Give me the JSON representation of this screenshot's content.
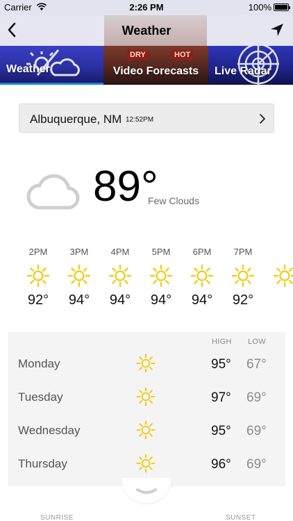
{
  "status_bar": {
    "carrier": "Carrier",
    "time": "2:26 PM",
    "battery": "100%"
  },
  "nav": {
    "title": "Weather"
  },
  "tabs": [
    {
      "label": "Weather",
      "selected": true
    },
    {
      "label": "Video Forecasts",
      "selected": false
    },
    {
      "label": "Live Radar",
      "selected": false
    }
  ],
  "video_signs": [
    "DRY",
    "HOT"
  ],
  "location": {
    "city": "Albuquerque, NM",
    "time": "12:52PM"
  },
  "current": {
    "temp": "89°",
    "condition": "Few Clouds",
    "icon": "cloud-icon"
  },
  "hourly": [
    {
      "time": "2PM",
      "temp": "92°",
      "icon": "sun-icon"
    },
    {
      "time": "3PM",
      "temp": "94°",
      "icon": "sun-icon"
    },
    {
      "time": "4PM",
      "temp": "94°",
      "icon": "sun-icon"
    },
    {
      "time": "5PM",
      "temp": "94°",
      "icon": "sun-icon"
    },
    {
      "time": "6PM",
      "temp": "94°",
      "icon": "sun-icon"
    },
    {
      "time": "7PM",
      "temp": "92°",
      "icon": "sun-icon"
    }
  ],
  "daily": {
    "high_label": "HIGH",
    "low_label": "LOW",
    "days": [
      {
        "name": "Monday",
        "high": "95°",
        "low": "67°",
        "icon": "sun-icon"
      },
      {
        "name": "Tuesday",
        "high": "97°",
        "low": "69°",
        "icon": "sun-icon"
      },
      {
        "name": "Wednesday",
        "high": "95°",
        "low": "69°",
        "icon": "sun-icon"
      },
      {
        "name": "Thursday",
        "high": "96°",
        "low": "69°",
        "icon": "sun-icon"
      }
    ]
  },
  "footer": {
    "sunrise_label": "SUNRISE",
    "sunset_label": "SUNSET"
  },
  "colors": {
    "sun": "#f2cd1c",
    "tab_underline": "#1f7fe0",
    "cloud": "#cfcfcf"
  }
}
